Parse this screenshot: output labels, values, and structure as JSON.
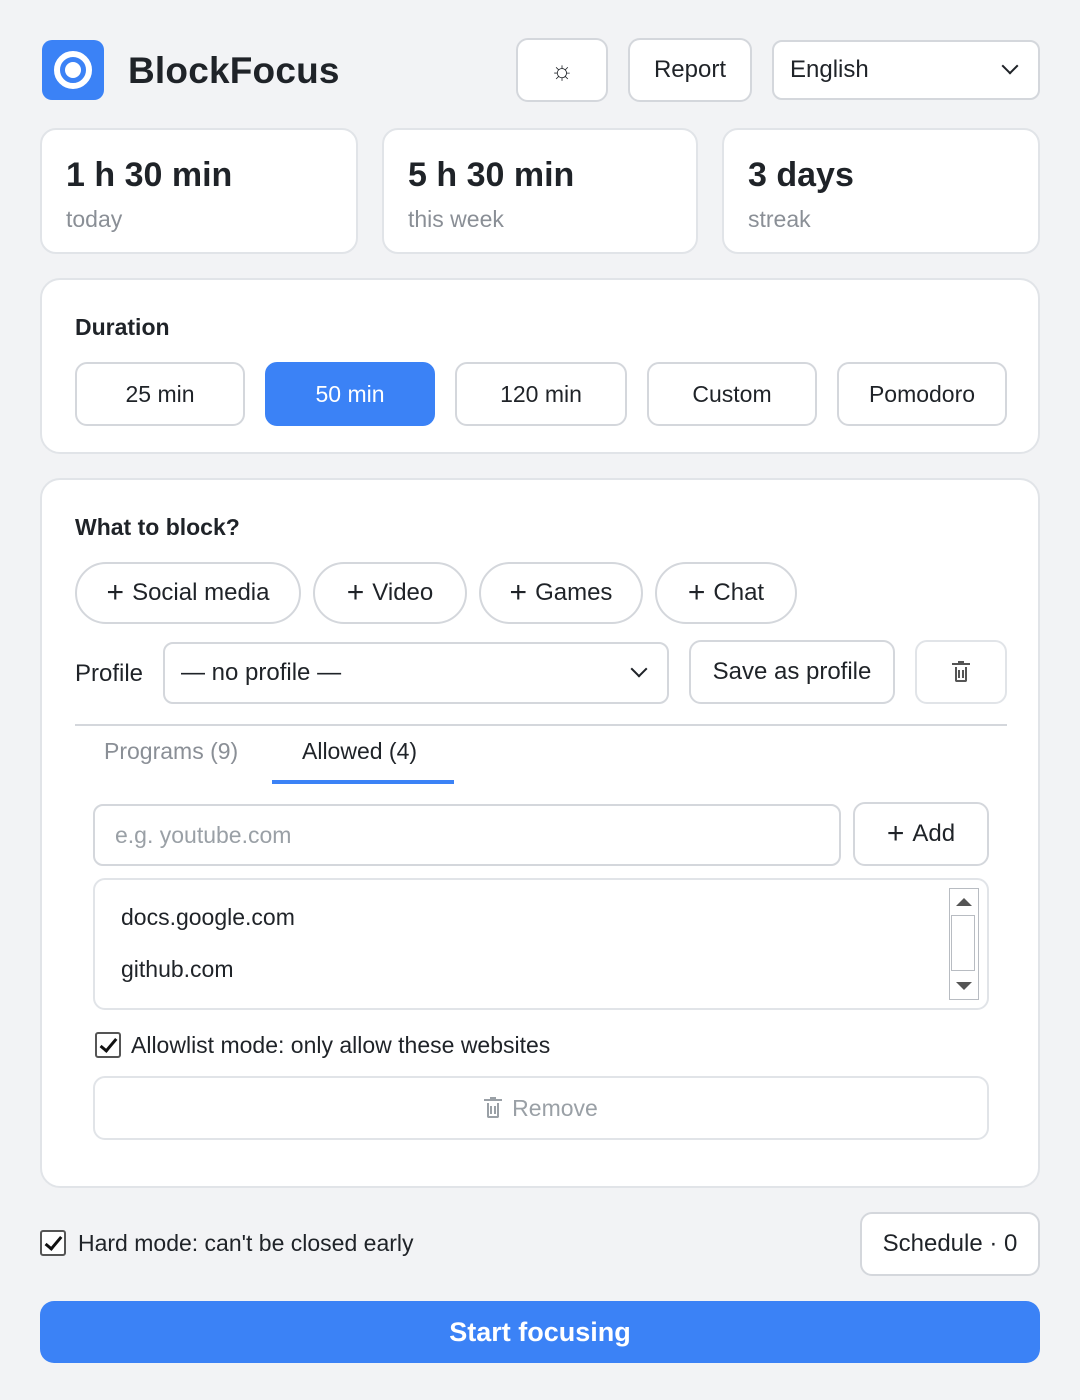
{
  "app": {
    "title": "BlockFocus"
  },
  "header": {
    "settings_icon": "gear-icon",
    "settings_glyph": "☼",
    "report_label": "Report",
    "language": "English"
  },
  "stats": [
    {
      "value": "1 h 30 min",
      "label": "today"
    },
    {
      "value": "5 h 30 min",
      "label": "this week"
    },
    {
      "value": "3 days",
      "label": "streak"
    }
  ],
  "duration": {
    "title": "Duration",
    "options": [
      "25 min",
      "50 min",
      "120 min",
      "Custom",
      "Pomodoro"
    ],
    "selected": "50 min"
  },
  "block": {
    "title": "What to block?",
    "categories": [
      "Social media",
      "Video",
      "Games",
      "Chat"
    ],
    "profile_label": "Profile",
    "profile_value": "— no profile —",
    "save_profile_label": "Save as profile",
    "tabs": [
      "Programs (9)",
      "Allowed (4)"
    ],
    "active_tab": "Allowed (4)",
    "input_placeholder": "e.g. youtube.com",
    "add_label": "Add",
    "allowed_sites": [
      "docs.google.com",
      "github.com"
    ],
    "allowlist_mode_label": "Allowlist mode: only allow these websites",
    "allowlist_mode_checked": true,
    "remove_label": "Remove"
  },
  "footer": {
    "hard_mode_label": "Hard mode: can't be closed early",
    "hard_mode_checked": true,
    "schedule_label": "Schedule · 0",
    "start_label": "Start focusing"
  },
  "colors": {
    "accent": "#3b82f6",
    "background": "#f2f3f5",
    "card": "#ffffff",
    "muted_text": "#8a8f96"
  }
}
